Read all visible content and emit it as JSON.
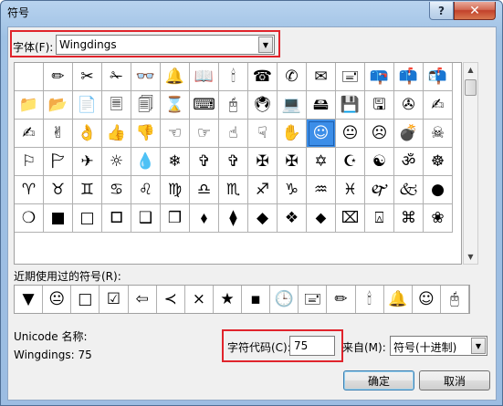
{
  "window": {
    "title": "符号",
    "help_label": "?",
    "close_label": "✕"
  },
  "font": {
    "label": "字体(F):",
    "value": "Wingdings"
  },
  "symbols": [
    "",
    "✏",
    "✂",
    "✁",
    "👓",
    "🔔",
    "📖",
    "🕯",
    "☎",
    "✆",
    "✉",
    "🖃",
    "📪",
    "📫",
    "📬",
    "📁",
    "📂",
    "📄",
    "🗏",
    "🗐",
    "⌛",
    "⌨",
    "🖰",
    "🖲",
    "💻",
    "🖴",
    "💾",
    "🖫",
    "✇",
    "✍",
    "✍",
    "✌",
    "👌",
    "👍",
    "👎",
    "☜",
    "☞",
    "☝",
    "☟",
    "✋",
    "☺",
    "😐",
    "☹",
    "💣",
    "☠",
    "⚐",
    "🏱",
    "✈",
    "☼",
    "💧",
    "❄",
    "✞",
    "✞",
    "✠",
    "✠",
    "✡",
    "☪",
    "☯",
    "ॐ",
    "☸",
    "♈",
    "♉",
    "♊",
    "♋",
    "♌",
    "♍",
    "♎",
    "♏",
    "♐",
    "♑",
    "♒",
    "♓",
    "🙰",
    "🙵",
    "●",
    "❍",
    "■",
    "□",
    "🞐",
    "❑",
    "❒",
    "⬧",
    "⧫",
    "◆",
    "❖",
    "⬥",
    "⌧",
    "⍓",
    "⌘",
    "❀"
  ],
  "selected_index": 40,
  "recent": {
    "label": "近期使用过的符号(R):",
    "symbols": [
      "▼",
      "😐",
      "□",
      "☑",
      "⇦",
      "≺",
      "×",
      "★",
      "▪",
      "🕒",
      "🖃",
      "✏",
      "🕯",
      "🔔",
      "☺",
      "🖰"
    ]
  },
  "unicode": {
    "name_label": "Unicode 名称:",
    "name_value": "Wingdings: 75"
  },
  "char_code": {
    "label": "字符代码(C):",
    "value": "75"
  },
  "from": {
    "label": "来自(M):",
    "value": "符号(十进制)"
  },
  "buttons": {
    "ok": "确定",
    "cancel": "取消"
  },
  "colors": {
    "highlight": "#e0242c",
    "selection": "#3c8ee8"
  }
}
